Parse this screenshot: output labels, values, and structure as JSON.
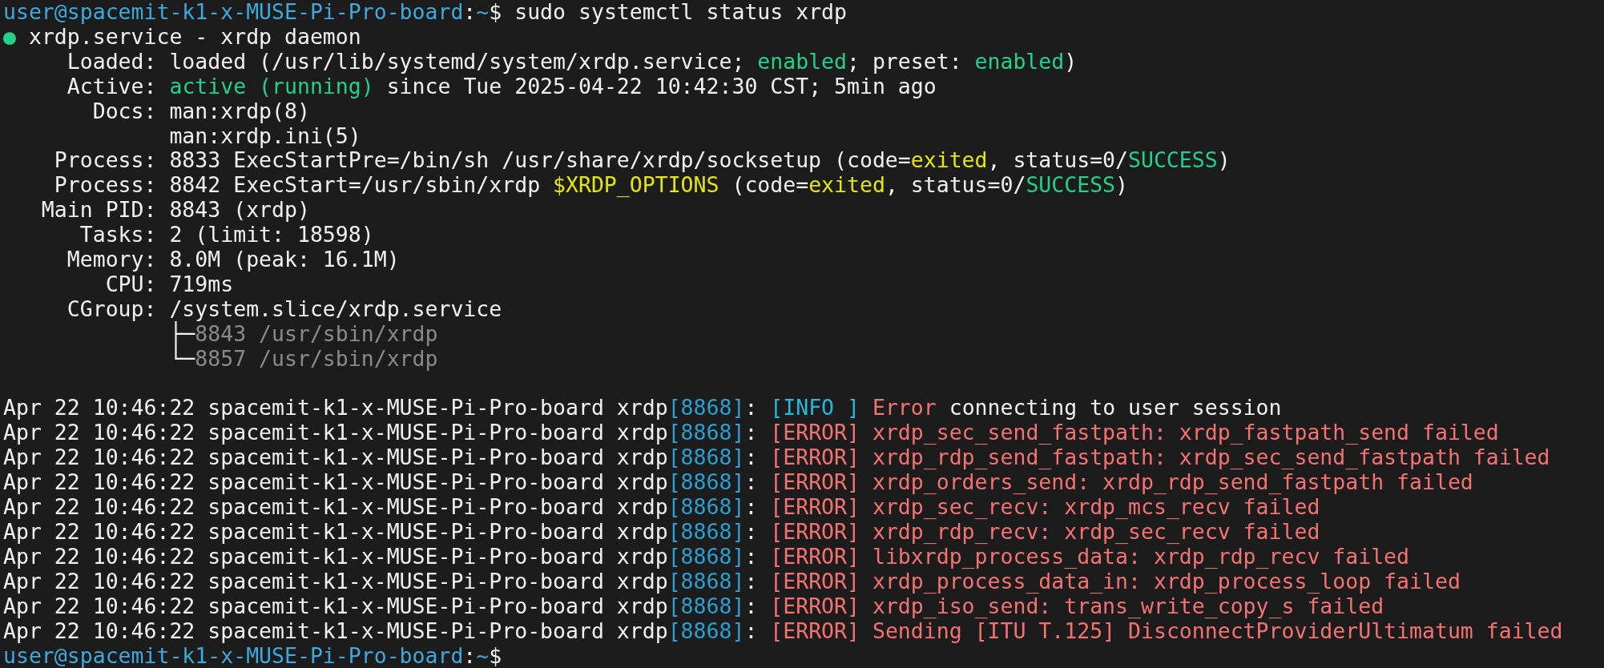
{
  "command_prompt": {
    "segments": [
      {
        "kind": "prompt",
        "text": "user@spacemit-k1-x-MUSE-Pi-Pro-board"
      },
      {
        "kind": "plain",
        "text": ":"
      },
      {
        "kind": "prompt",
        "text": "~"
      },
      {
        "kind": "plain",
        "text": "$ sudo systemctl status xrdp"
      }
    ]
  },
  "status_lines": [
    {
      "segments": [
        {
          "kind": "green",
          "text": "●"
        },
        {
          "kind": "plain",
          "text": " xrdp.service - xrdp daemon"
        }
      ]
    },
    {
      "segments": [
        {
          "kind": "plain",
          "text": "     Loaded: loaded (/usr/lib/systemd/system/xrdp.service; "
        },
        {
          "kind": "green",
          "text": "enabled"
        },
        {
          "kind": "plain",
          "text": "; preset: "
        },
        {
          "kind": "green",
          "text": "enabled"
        },
        {
          "kind": "plain",
          "text": ")"
        }
      ]
    },
    {
      "segments": [
        {
          "kind": "plain",
          "text": "     Active: "
        },
        {
          "kind": "green",
          "text": "active (running)"
        },
        {
          "kind": "plain",
          "text": " since Tue 2025-04-22 10:42:30 CST; 5min ago"
        }
      ]
    },
    {
      "segments": [
        {
          "kind": "plain",
          "text": "       Docs: man:xrdp(8)"
        }
      ]
    },
    {
      "segments": [
        {
          "kind": "plain",
          "text": "             man:xrdp.ini(5)"
        }
      ]
    },
    {
      "segments": [
        {
          "kind": "plain",
          "text": "    Process: 8833 ExecStartPre=/bin/sh /usr/share/xrdp/socksetup (code="
        },
        {
          "kind": "yellow",
          "text": "exited"
        },
        {
          "kind": "plain",
          "text": ", status=0/"
        },
        {
          "kind": "green",
          "text": "SUCCESS"
        },
        {
          "kind": "plain",
          "text": ")"
        }
      ]
    },
    {
      "segments": [
        {
          "kind": "plain",
          "text": "    Process: 8842 ExecStart=/usr/sbin/xrdp "
        },
        {
          "kind": "yellow",
          "text": "$XRDP_OPTIONS"
        },
        {
          "kind": "plain",
          "text": " (code="
        },
        {
          "kind": "yellow",
          "text": "exited"
        },
        {
          "kind": "plain",
          "text": ", status=0/"
        },
        {
          "kind": "green",
          "text": "SUCCESS"
        },
        {
          "kind": "plain",
          "text": ")"
        }
      ]
    },
    {
      "segments": [
        {
          "kind": "plain",
          "text": "   Main PID: 8843 (xrdp)"
        }
      ]
    },
    {
      "segments": [
        {
          "kind": "plain",
          "text": "      Tasks: 2 (limit: 18598)"
        }
      ]
    },
    {
      "segments": [
        {
          "kind": "plain",
          "text": "     Memory: 8.0M (peak: 16.1M)"
        }
      ]
    },
    {
      "segments": [
        {
          "kind": "plain",
          "text": "        CPU: 719ms"
        }
      ]
    },
    {
      "segments": [
        {
          "kind": "plain",
          "text": "     CGroup: /system.slice/xrdp.service"
        }
      ]
    },
    {
      "segments": [
        {
          "kind": "plain",
          "text": "             ├─"
        },
        {
          "kind": "dim",
          "text": "8843 /usr/sbin/xrdp"
        }
      ]
    },
    {
      "segments": [
        {
          "kind": "plain",
          "text": "             └─"
        },
        {
          "kind": "dim",
          "text": "8857 /usr/sbin/xrdp"
        }
      ]
    }
  ],
  "journal_lines": [
    {
      "segments": [
        {
          "kind": "plain",
          "text": "Apr 22 10:46:22 spacemit-k1-x-MUSE-Pi-Pro-board xrdp"
        },
        {
          "kind": "blue",
          "text": "[8868]"
        },
        {
          "kind": "plain",
          "text": ": "
        },
        {
          "kind": "cyan",
          "text": "[INFO ]"
        },
        {
          "kind": "red",
          "text": " Error"
        },
        {
          "kind": "plain",
          "text": " connecting to user session"
        }
      ]
    },
    {
      "segments": [
        {
          "kind": "plain",
          "text": "Apr 22 10:46:22 spacemit-k1-x-MUSE-Pi-Pro-board xrdp"
        },
        {
          "kind": "blue",
          "text": "[8868]"
        },
        {
          "kind": "plain",
          "text": ": "
        },
        {
          "kind": "red",
          "text": "[ERROR] xrdp_sec_send_fastpath: xrdp_fastpath_send failed"
        }
      ]
    },
    {
      "segments": [
        {
          "kind": "plain",
          "text": "Apr 22 10:46:22 spacemit-k1-x-MUSE-Pi-Pro-board xrdp"
        },
        {
          "kind": "blue",
          "text": "[8868]"
        },
        {
          "kind": "plain",
          "text": ": "
        },
        {
          "kind": "red",
          "text": "[ERROR] xrdp_rdp_send_fastpath: xrdp_sec_send_fastpath failed"
        }
      ]
    },
    {
      "segments": [
        {
          "kind": "plain",
          "text": "Apr 22 10:46:22 spacemit-k1-x-MUSE-Pi-Pro-board xrdp"
        },
        {
          "kind": "blue",
          "text": "[8868]"
        },
        {
          "kind": "plain",
          "text": ": "
        },
        {
          "kind": "red",
          "text": "[ERROR] xrdp_orders_send: xrdp_rdp_send_fastpath failed"
        }
      ]
    },
    {
      "segments": [
        {
          "kind": "plain",
          "text": "Apr 22 10:46:22 spacemit-k1-x-MUSE-Pi-Pro-board xrdp"
        },
        {
          "kind": "blue",
          "text": "[8868]"
        },
        {
          "kind": "plain",
          "text": ": "
        },
        {
          "kind": "red",
          "text": "[ERROR] xrdp_sec_recv: xrdp_mcs_recv failed"
        }
      ]
    },
    {
      "segments": [
        {
          "kind": "plain",
          "text": "Apr 22 10:46:22 spacemit-k1-x-MUSE-Pi-Pro-board xrdp"
        },
        {
          "kind": "blue",
          "text": "[8868]"
        },
        {
          "kind": "plain",
          "text": ": "
        },
        {
          "kind": "red",
          "text": "[ERROR] xrdp_rdp_recv: xrdp_sec_recv failed"
        }
      ]
    },
    {
      "segments": [
        {
          "kind": "plain",
          "text": "Apr 22 10:46:22 spacemit-k1-x-MUSE-Pi-Pro-board xrdp"
        },
        {
          "kind": "blue",
          "text": "[8868]"
        },
        {
          "kind": "plain",
          "text": ": "
        },
        {
          "kind": "red",
          "text": "[ERROR] libxrdp_process_data: xrdp_rdp_recv failed"
        }
      ]
    },
    {
      "segments": [
        {
          "kind": "plain",
          "text": "Apr 22 10:46:22 spacemit-k1-x-MUSE-Pi-Pro-board xrdp"
        },
        {
          "kind": "blue",
          "text": "[8868]"
        },
        {
          "kind": "plain",
          "text": ": "
        },
        {
          "kind": "red",
          "text": "[ERROR] xrdp_process_data_in: xrdp_process_loop failed"
        }
      ]
    },
    {
      "segments": [
        {
          "kind": "plain",
          "text": "Apr 22 10:46:22 spacemit-k1-x-MUSE-Pi-Pro-board xrdp"
        },
        {
          "kind": "blue",
          "text": "[8868]"
        },
        {
          "kind": "plain",
          "text": ": "
        },
        {
          "kind": "red",
          "text": "[ERROR] xrdp_iso_send: trans_write_copy_s failed"
        }
      ]
    },
    {
      "segments": [
        {
          "kind": "plain",
          "text": "Apr 22 10:46:22 spacemit-k1-x-MUSE-Pi-Pro-board xrdp"
        },
        {
          "kind": "blue",
          "text": "[8868]"
        },
        {
          "kind": "plain",
          "text": ": "
        },
        {
          "kind": "red",
          "text": "[ERROR] Sending [ITU T.125] DisconnectProviderUltimatum failed"
        }
      ]
    }
  ],
  "final_prompt": {
    "segments": [
      {
        "kind": "prompt",
        "text": "user@spacemit-k1-x-MUSE-Pi-Pro-board"
      },
      {
        "kind": "plain",
        "text": ":"
      },
      {
        "kind": "prompt",
        "text": "~"
      },
      {
        "kind": "plain",
        "text": "$"
      }
    ]
  }
}
